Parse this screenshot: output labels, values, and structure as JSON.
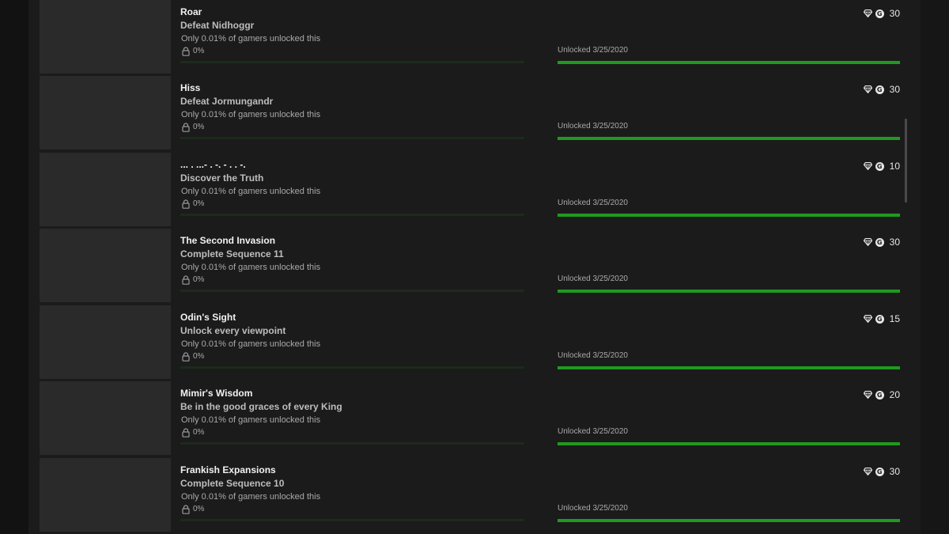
{
  "colors": {
    "background": "#161616",
    "panel": "#1b1b1b",
    "thumbnail": "#2a2a2a",
    "progress_green": "#1f9a1f"
  },
  "achievements": [
    {
      "title": "Roar",
      "description": "Defeat Nidhoggr",
      "rarity": "Only 0.01% of gamers unlocked this",
      "percent_label": "0%",
      "percent_value": 0.01,
      "unlocked": "Unlocked 3/25/2020",
      "unlock_progress": 100,
      "icons": [
        "diamond-icon",
        "gamerscore-icon"
      ],
      "score": "30"
    },
    {
      "title": "Hiss",
      "description": "Defeat Jormungandr",
      "rarity": "Only 0.01% of gamers unlocked this",
      "percent_label": "0%",
      "percent_value": 0.01,
      "unlocked": "Unlocked 3/25/2020",
      "unlock_progress": 100,
      "icons": [
        "diamond-icon",
        "gamerscore-icon"
      ],
      "score": "30"
    },
    {
      "title": "... . ...- . -. - . . -.",
      "description": "Discover the Truth",
      "rarity": "Only 0.01% of gamers unlocked this",
      "percent_label": "0%",
      "percent_value": 0.01,
      "unlocked": "Unlocked 3/25/2020",
      "unlock_progress": 100,
      "icons": [
        "diamond-icon",
        "gamerscore-icon"
      ],
      "score": "10"
    },
    {
      "title": "The Second Invasion",
      "description": "Complete Sequence 11",
      "rarity": "Only 0.01% of gamers unlocked this",
      "percent_label": "0%",
      "percent_value": 0.01,
      "unlocked": "Unlocked 3/25/2020",
      "unlock_progress": 100,
      "icons": [
        "diamond-icon",
        "gamerscore-icon"
      ],
      "score": "30"
    },
    {
      "title": "Odin's Sight",
      "description": "Unlock every viewpoint",
      "rarity": "Only 0.01% of gamers unlocked this",
      "percent_label": "0%",
      "percent_value": 0.01,
      "unlocked": "Unlocked 3/25/2020",
      "unlock_progress": 100,
      "icons": [
        "diamond-icon",
        "gamerscore-icon"
      ],
      "score": "15"
    },
    {
      "title": "Mimir's Wisdom",
      "description": "Be in the good graces of every King",
      "rarity": "Only 0.01% of gamers unlocked this",
      "percent_label": "0%",
      "percent_value": 0.01,
      "unlocked": "Unlocked 3/25/2020",
      "unlock_progress": 100,
      "icons": [
        "diamond-icon",
        "gamerscore-icon"
      ],
      "score": "20"
    },
    {
      "title": "Frankish Expansions",
      "description": "Complete Sequence 10",
      "rarity": "Only 0.01% of gamers unlocked this",
      "percent_label": "0%",
      "percent_value": 0.01,
      "unlocked": "Unlocked 3/25/2020",
      "unlock_progress": 100,
      "icons": [
        "diamond-icon",
        "gamerscore-icon"
      ],
      "score": "30"
    }
  ]
}
